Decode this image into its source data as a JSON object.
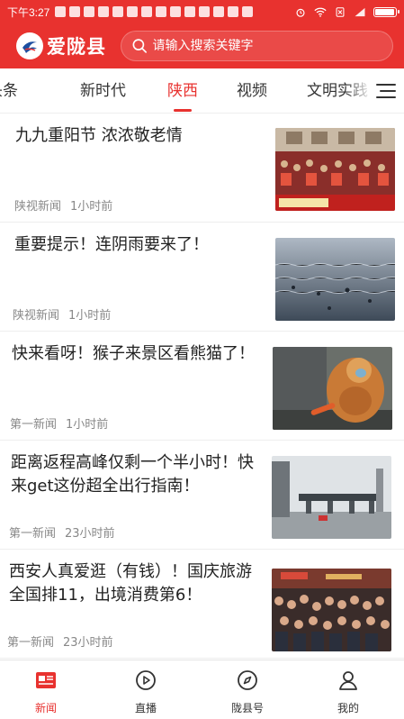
{
  "status_bar": {
    "time": "下午3:27",
    "battery_level_percent": 95
  },
  "header": {
    "app_name": "爱陇县",
    "search_placeholder": "请输入搜索关键字"
  },
  "tabs": [
    {
      "label": "头条",
      "visible_text": "头条",
      "active": false
    },
    {
      "label": "新时代",
      "active": false
    },
    {
      "label": "陕西",
      "active": true
    },
    {
      "label": "视频",
      "active": false
    },
    {
      "label": "文明实践",
      "visible_text": "文明实践",
      "active": false
    }
  ],
  "news": [
    {
      "title": "九九重阳节 浓浓敬老情",
      "source": "陕视新闻",
      "time": "1小时前",
      "thumb_icon": "event-crowd-photo"
    },
    {
      "title": "重要提示！连阴雨要来了！",
      "source": "陕视新闻",
      "time": "1小时前",
      "thumb_icon": "rain-water-photo"
    },
    {
      "title": "快来看呀！猴子来景区看熊猫了！",
      "source": "第一新闻",
      "time": "1小时前",
      "thumb_icon": "monkey-photo"
    },
    {
      "title": "距离返程高峰仅剩一个半小时！快来get这份超全出行指南！",
      "source": "第一新闻",
      "time": "23小时前",
      "thumb_icon": "toll-station-photo"
    },
    {
      "title": "西安人真爱逛（有钱）！国庆旅游全国排11，出境消费第6！",
      "source": "第一新闻",
      "time": "23小时前",
      "thumb_icon": "crowd-street-photo"
    }
  ],
  "bottom_nav": [
    {
      "label": "新闻",
      "icon": "news-icon",
      "active": true
    },
    {
      "label": "直播",
      "icon": "live-icon",
      "active": false
    },
    {
      "label": "陇县号",
      "icon": "compass-icon",
      "active": false
    },
    {
      "label": "我的",
      "icon": "person-icon",
      "active": false
    }
  ],
  "colors": {
    "brand": "#e8322f",
    "text": "#222222",
    "meta": "#888888"
  }
}
